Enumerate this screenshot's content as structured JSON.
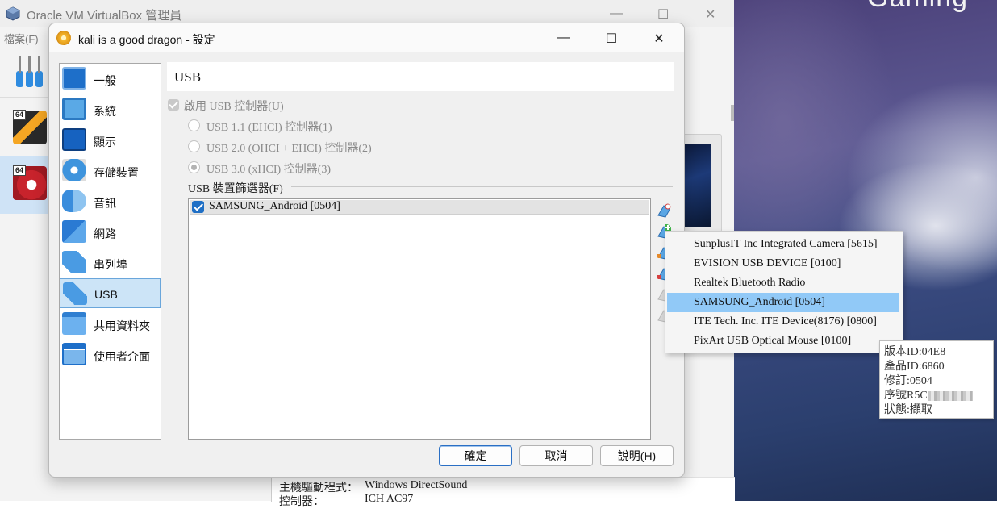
{
  "manager": {
    "title": "Oracle VM VirtualBox 管理員",
    "menu_file": "檔案(F)",
    "vm_badge": "64",
    "details": [
      {
        "label": "主機驅動程式：",
        "value": "Windows DirectSound"
      },
      {
        "label": "控制器：",
        "value": "ICH AC97"
      }
    ]
  },
  "dialog": {
    "title": "kali is a good dragon - 設定",
    "categories": [
      {
        "label": "一般",
        "icon": "general-icon"
      },
      {
        "label": "系統",
        "icon": "system-chip-icon"
      },
      {
        "label": "顯示",
        "icon": "display-monitor-icon"
      },
      {
        "label": "存儲裝置",
        "icon": "storage-disk-icon"
      },
      {
        "label": "音訊",
        "icon": "audio-speaker-icon"
      },
      {
        "label": "網路",
        "icon": "network-icon"
      },
      {
        "label": "串列埠",
        "icon": "serial-port-icon"
      },
      {
        "label": "USB",
        "icon": "usb-icon"
      },
      {
        "label": "共用資料夾",
        "icon": "shared-folder-icon"
      },
      {
        "label": "使用者介面",
        "icon": "user-interface-icon"
      }
    ],
    "selected_category": "USB",
    "section_title": "USB",
    "enable_usb": "啟用 USB 控制器(U)",
    "usb_options": [
      {
        "label": "USB 1.1 (EHCI) 控制器(1)",
        "checked": false
      },
      {
        "label": "USB 2.0 (OHCI + EHCI) 控制器(2)",
        "checked": false
      },
      {
        "label": "USB 3.0 (xHCI) 控制器(3)",
        "checked": true
      }
    ],
    "filters_label": "USB 裝置篩選器(F)",
    "filters": [
      {
        "label": "SAMSUNG_Android [0504]",
        "checked": true
      }
    ],
    "buttons": {
      "ok": "確定",
      "cancel": "取消",
      "help": "說明(H)"
    }
  },
  "device_menu": {
    "items": [
      "SunplusIT Inc Integrated Camera [5615]",
      "EVISION USB DEVICE [0100]",
      "Realtek Bluetooth Radio",
      "SAMSUNG_Android [0504]",
      "ITE Tech. Inc. ITE Device(8176) [0800]",
      "PixArt USB Optical Mouse [0100]"
    ],
    "highlighted_index": 3
  },
  "tooltip": {
    "vendor": "版本ID:04E8",
    "product": "產品ID:6860",
    "revision": "修訂:0504",
    "serial": "序號R5C",
    "state": "狀態:擷取"
  },
  "colors": {
    "accent": "#1f6fc5",
    "selection": "#cce4f7",
    "menu_highlight": "#91c9f7"
  }
}
